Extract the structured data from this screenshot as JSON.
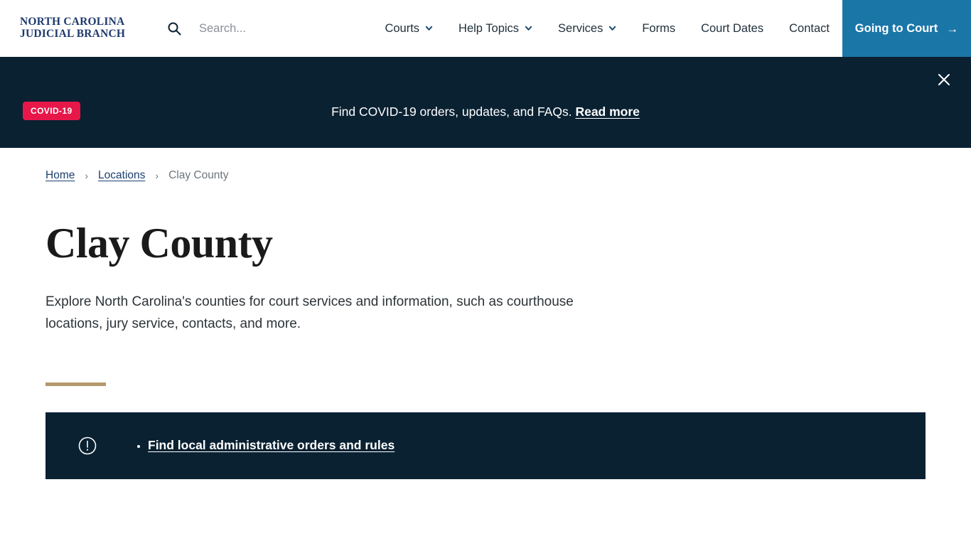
{
  "header": {
    "logo": {
      "line1": "NORTH CAROLINA",
      "line2": "JUDICIAL BRANCH",
      "icon": "none"
    },
    "search": {
      "icon": "search-icon",
      "placeholder": "Search...",
      "value": ""
    },
    "nav": [
      {
        "label": "Courts",
        "has_dropdown": true,
        "icon": "chevron-down-icon"
      },
      {
        "label": "Help Topics",
        "has_dropdown": true,
        "icon": "chevron-down-icon"
      },
      {
        "label": "Services",
        "has_dropdown": true,
        "icon": "chevron-down-icon"
      },
      {
        "label": "Forms",
        "has_dropdown": false
      },
      {
        "label": "Court Dates",
        "has_dropdown": false
      },
      {
        "label": "Contact",
        "has_dropdown": false
      }
    ],
    "cta": {
      "label": "Going to Court",
      "arrow": "→",
      "icon": "arrow-right-icon",
      "background": "#1b76a8"
    }
  },
  "banner": {
    "badge": "COVID-19",
    "badge_color": "#e8174a",
    "background": "#0a2132",
    "message": "Find COVID-19 orders, updates, and FAQs.",
    "link_label": "Read more",
    "close_icon": "close-icon"
  },
  "breadcrumb": {
    "items": [
      {
        "label": "Home",
        "is_link": true
      },
      {
        "label": "Locations",
        "is_link": true
      },
      {
        "label": "Clay County",
        "is_link": false
      }
    ],
    "separator": "›"
  },
  "page": {
    "title": "Clay County",
    "lede": "Explore North Carolina's counties for court services and information, such as courthouse locations, jury service, contacts, and more.",
    "rule_color": "#b3986c"
  },
  "alert": {
    "icon": "exclamation-circle-icon",
    "background": "#0a2132",
    "items": [
      {
        "label": "Find local administrative orders and rules"
      }
    ]
  }
}
